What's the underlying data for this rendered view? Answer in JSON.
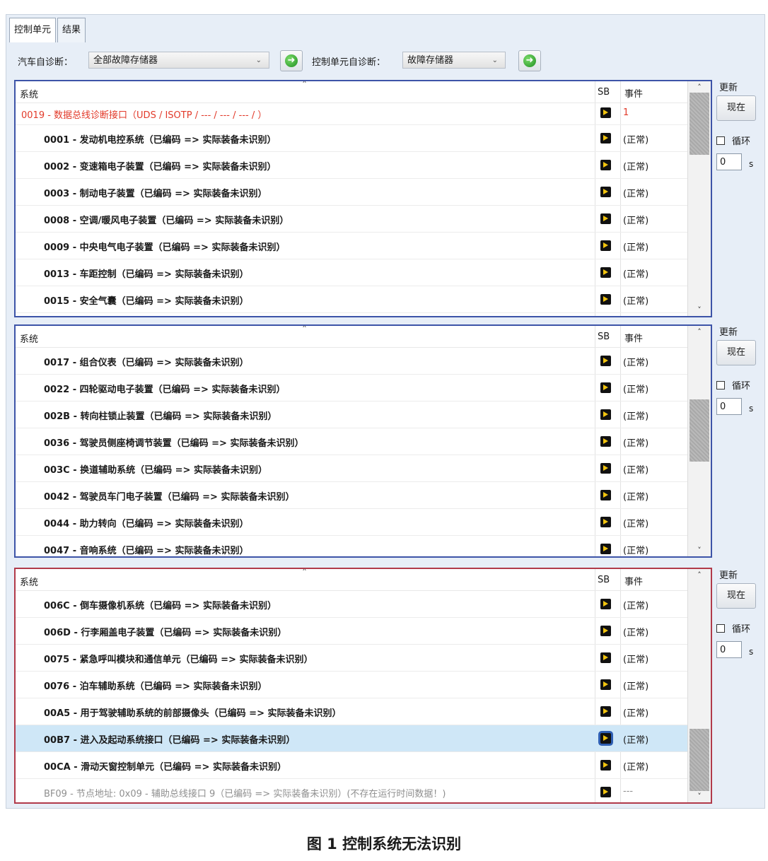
{
  "tabs": [
    {
      "label": "控制单元"
    },
    {
      "label": "结果"
    }
  ],
  "toolbar": {
    "car_diag_label": "汽车自诊断：",
    "car_diag_value": "全部故障存储器",
    "unit_diag_label": "控制单元自诊断：",
    "unit_diag_value": "故障存储器"
  },
  "columns": {
    "system": "系统",
    "sb": "SB",
    "event": "事件"
  },
  "side": {
    "update": "更新",
    "now": "现在",
    "loop": "循环",
    "interval": "0",
    "unit": "s"
  },
  "panels": [
    {
      "rows": [
        {
          "name": "0019 - 数据总线诊断接口（UDS / ISOTP / --- / --- / --- / ）",
          "event": "1"
        },
        {
          "name": "0001 - 发动机电控系统（已编码 => 实际装备未识别）",
          "event": "(正常)"
        },
        {
          "name": "0002 - 变速箱电子装置（已编码 => 实际装备未识别）",
          "event": "(正常)"
        },
        {
          "name": "0003 - 制动电子装置（已编码 => 实际装备未识别）",
          "event": "(正常)"
        },
        {
          "name": "0008 - 空调/暖风电子装置（已编码 => 实际装备未识别）",
          "event": "(正常)"
        },
        {
          "name": "0009 - 中央电气电子装置（已编码 => 实际装备未识别）",
          "event": "(正常)"
        },
        {
          "name": "0013 - 车距控制（已编码 => 实际装备未识别）",
          "event": "(正常)"
        },
        {
          "name": "0015 - 安全气囊（已编码 => 实际装备未识别）",
          "event": "(正常)"
        }
      ]
    },
    {
      "rows": [
        {
          "name": "0017 - 组合仪表（已编码 => 实际装备未识别）",
          "event": "(正常)"
        },
        {
          "name": "0022 - 四轮驱动电子装置（已编码 => 实际装备未识别）",
          "event": "(正常)"
        },
        {
          "name": "002B - 转向柱锁止装置（已编码 => 实际装备未识别）",
          "event": "(正常)"
        },
        {
          "name": "0036 - 驾驶员侧座椅调节装置（已编码 => 实际装备未识别）",
          "event": "(正常)"
        },
        {
          "name": "003C - 换道辅助系统（已编码 => 实际装备未识别）",
          "event": "(正常)"
        },
        {
          "name": "0042 - 驾驶员车门电子装置（已编码 => 实际装备未识别）",
          "event": "(正常)"
        },
        {
          "name": "0044 - 助力转向（已编码 => 实际装备未识别）",
          "event": "(正常)"
        },
        {
          "name": "0047 - 音响系统（已编码 => 实际装备未识别）",
          "event": "(正常)"
        }
      ]
    },
    {
      "rows": [
        {
          "name": "006C - 倒车摄像机系统（已编码 => 实际装备未识别）",
          "event": "(正常)"
        },
        {
          "name": "006D - 行李厢盖电子装置（已编码 => 实际装备未识别）",
          "event": "(正常)"
        },
        {
          "name": "0075 - 紧急呼叫模块和通信单元（已编码 => 实际装备未识别）",
          "event": "(正常)"
        },
        {
          "name": "0076 - 泊车辅助系统（已编码 => 实际装备未识别）",
          "event": "(正常)"
        },
        {
          "name": "00A5 - 用于驾驶辅助系统的前部摄像头（已编码 => 实际装备未识别）",
          "event": "(正常)"
        },
        {
          "name": "00B7 - 进入及起动系统接口（已编码 => 实际装备未识别）",
          "event": "(正常)"
        },
        {
          "name": "00CA - 滑动天窗控制单元（已编码 => 实际装备未识别）",
          "event": "(正常)"
        },
        {
          "name": "BF09 - 节点地址: 0x09 - 辅助总线接口 9（已编码 => 实际装备未识别）(不存在运行时间数据！)",
          "event": "---"
        }
      ]
    }
  ],
  "caption": "图 1  控制系统无法识别"
}
